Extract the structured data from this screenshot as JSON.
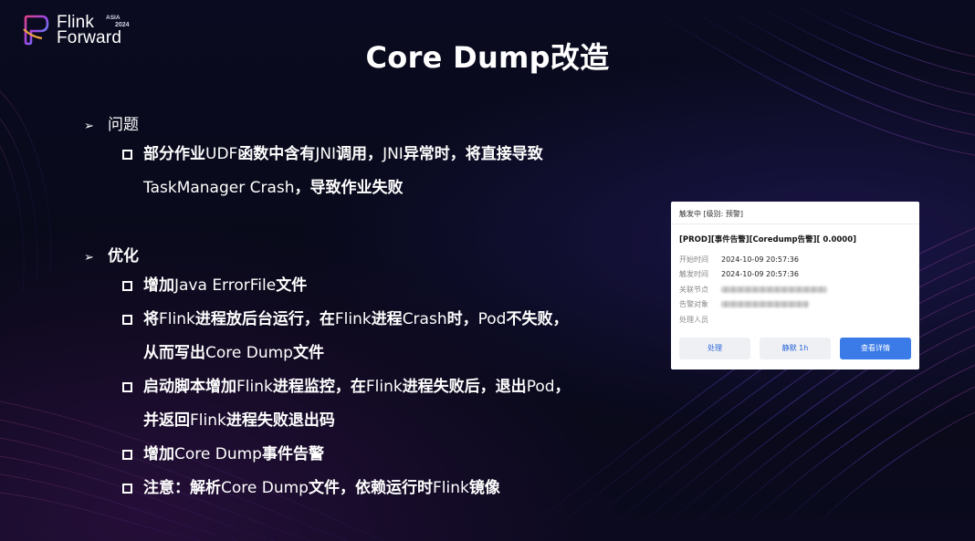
{
  "logo": {
    "word1": "Flink",
    "word2": "Forward",
    "tag": "ASIA",
    "year": "2024"
  },
  "title": "Core Dump改造",
  "sections": {
    "problem": {
      "heading": "问题",
      "items": [
        {
          "line1": [
            {
              "t": "部分作业",
              "w": "b"
            },
            {
              "t": "UDF",
              "w": "n"
            },
            {
              "t": "函数中含有",
              "w": "b"
            },
            {
              "t": "JNI",
              "w": "n"
            },
            {
              "t": "调用，",
              "w": "b"
            },
            {
              "t": "JNI",
              "w": "n"
            },
            {
              "t": "异常时，将直接导致",
              "w": "b"
            }
          ],
          "line2": [
            {
              "t": "TaskManager Crash",
              "w": "n"
            },
            {
              "t": "，导致作业失败",
              "w": "b"
            }
          ]
        }
      ]
    },
    "optimize": {
      "heading": "优化",
      "items": [
        {
          "line1": [
            {
              "t": "增加",
              "w": "b"
            },
            {
              "t": "Java ErrorFile",
              "w": "n"
            },
            {
              "t": "文件",
              "w": "b"
            }
          ]
        },
        {
          "line1": [
            {
              "t": "将",
              "w": "b"
            },
            {
              "t": "Flink",
              "w": "n"
            },
            {
              "t": "进程放后台运行，在",
              "w": "b"
            },
            {
              "t": "Flink",
              "w": "n"
            },
            {
              "t": "进程",
              "w": "b"
            },
            {
              "t": "Crash",
              "w": "n"
            },
            {
              "t": "时，",
              "w": "b"
            },
            {
              "t": "Pod",
              "w": "n"
            },
            {
              "t": "不失败，",
              "w": "b"
            }
          ],
          "line2": [
            {
              "t": "从而写出",
              "w": "b"
            },
            {
              "t": "Core Dump",
              "w": "n"
            },
            {
              "t": "文件",
              "w": "b"
            }
          ]
        },
        {
          "line1": [
            {
              "t": "启动脚本增加",
              "w": "b"
            },
            {
              "t": "Flink",
              "w": "n"
            },
            {
              "t": "进程监控，在",
              "w": "b"
            },
            {
              "t": "Flink",
              "w": "n"
            },
            {
              "t": "进程失败后，退出",
              "w": "b"
            },
            {
              "t": "Pod",
              "w": "n"
            },
            {
              "t": "，",
              "w": "b"
            }
          ],
          "line2": [
            {
              "t": "并返回",
              "w": "b"
            },
            {
              "t": "Flink",
              "w": "n"
            },
            {
              "t": "进程失败退出码",
              "w": "b"
            }
          ]
        },
        {
          "line1": [
            {
              "t": "增加",
              "w": "b"
            },
            {
              "t": "Core Dump",
              "w": "n"
            },
            {
              "t": "事件告警",
              "w": "b"
            }
          ]
        },
        {
          "line1": [
            {
              "t": "注意：解析",
              "w": "b"
            },
            {
              "t": "Core Dump",
              "w": "n"
            },
            {
              "t": "文件，依赖运行时",
              "w": "b"
            },
            {
              "t": "Flink",
              "w": "n"
            },
            {
              "t": "镜像",
              "w": "b"
            }
          ]
        }
      ]
    }
  },
  "alert_card": {
    "status": "触发中 [级别: 预警]",
    "title": "[PROD][事件告警][Coredump告警][ 0.0000]",
    "rows": [
      {
        "key": "开始时间",
        "value": "2024-10-09 20:57:36"
      },
      {
        "key": "触发时间",
        "value": "2024-10-09 20:57:36"
      },
      {
        "key": "关联节点",
        "value": ""
      },
      {
        "key": "告警对象",
        "value": ""
      },
      {
        "key": "处理人员",
        "value": ""
      }
    ],
    "buttons": {
      "handle": "处理",
      "mute": "静默 1h",
      "details": "查看详情"
    }
  },
  "colors": {
    "background": "#07081a",
    "text": "#ffffff",
    "primary_button": "#3a7be8",
    "light_button": "#eef0f4"
  }
}
